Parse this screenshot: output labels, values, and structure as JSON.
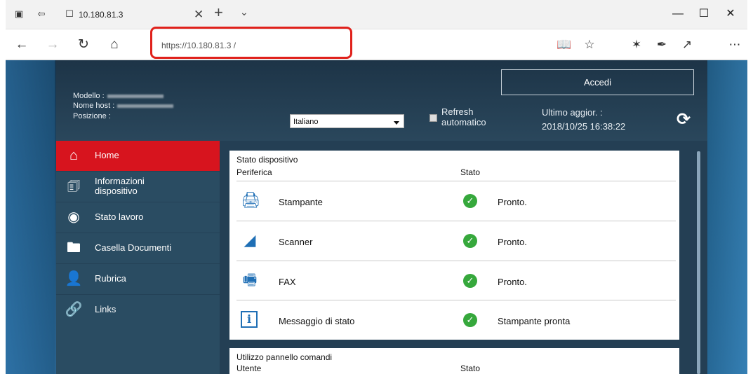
{
  "browser": {
    "tab_title": "10.180.81.3",
    "address": "https://10.180.81.3 /",
    "icons": [
      "tab-actions-icon",
      "tab-aside-icon",
      "page-icon",
      "close-icon",
      "new-tab-icon",
      "tab-list-icon",
      "minimize-icon",
      "maximize-icon",
      "close-window-icon",
      "back-icon",
      "forward-icon",
      "refresh-icon",
      "home-icon",
      "reading-view-icon",
      "favorite-star-icon",
      "favorites-icon",
      "notes-icon",
      "share-icon",
      "more-icon"
    ]
  },
  "header": {
    "model_label": "Modello :",
    "host_label": "Nome host :",
    "position_label": "Posizione :",
    "language": "Italiano",
    "refresh_label": "Refresh",
    "refresh_label2": "automatico",
    "updated_label": "Ultimo aggior. :",
    "updated_value": "2018/10/25 16:38:22",
    "login_button": "Accedi"
  },
  "sidebar": {
    "items": [
      {
        "label": "Home",
        "icon": "home-icon"
      },
      {
        "label": "Informazioni",
        "label2": "dispositivo",
        "icon": "device-info-icon"
      },
      {
        "label": "Stato lavoro",
        "icon": "job-status-icon"
      },
      {
        "label": "Casella Documenti",
        "icon": "document-box-icon"
      },
      {
        "label": "Rubrica",
        "icon": "address-book-icon"
      },
      {
        "label": "Links",
        "icon": "links-icon"
      }
    ]
  },
  "device_status": {
    "title": "Stato dispositivo",
    "col_device": "Periferica",
    "col_status": "Stato",
    "rows": [
      {
        "name": "Stampante",
        "status": "Pronto.",
        "icon": "printer-icon"
      },
      {
        "name": "Scanner",
        "status": "Pronto.",
        "icon": "scanner-icon"
      },
      {
        "name": "FAX",
        "status": "Pronto.",
        "icon": "fax-icon"
      },
      {
        "name": "Messaggio di stato",
        "status": "Stampante pronta",
        "icon": "info-icon"
      }
    ]
  },
  "panel_usage": {
    "title": "Utilizzo pannello comandi",
    "col_user": "Utente",
    "col_status": "Stato"
  },
  "colors": {
    "accent_red": "#d7141e",
    "ok_green": "#36a83c",
    "highlight": "#e0211b"
  }
}
